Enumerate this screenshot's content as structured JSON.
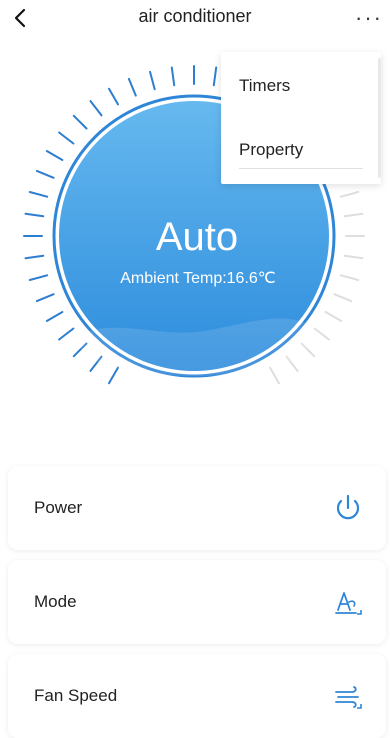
{
  "header": {
    "title": "air conditioner",
    "more_label": "···"
  },
  "dial": {
    "mode": "Auto",
    "ambient": "Ambient Temp:16.6℃"
  },
  "menu": {
    "items": [
      {
        "label": "Timers"
      },
      {
        "label": "Property"
      }
    ]
  },
  "controls": [
    {
      "label": "Power",
      "icon": "power-icon"
    },
    {
      "label": "Mode",
      "icon": "mode-icon"
    },
    {
      "label": "Fan Speed",
      "icon": "fan-speed-icon"
    }
  ],
  "colors": {
    "accent": "#2f86d8",
    "dial_fill_top": "#64b7ee",
    "dial_fill_bottom": "#2e8fdc",
    "tick_active": "#2c7ed0",
    "tick_inactive": "#dedede"
  }
}
